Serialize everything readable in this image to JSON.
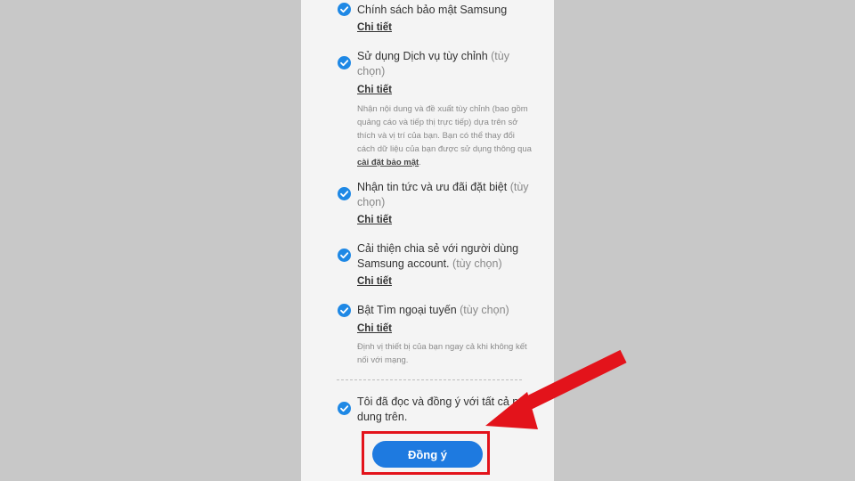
{
  "consents": [
    {
      "title": "Chính sách bảo mật Samsung",
      "optional": "",
      "detail": "Chi tiết",
      "description": ""
    },
    {
      "title": "Sử dụng Dịch vụ tùy chỉnh",
      "optional": "(tùy chọn)",
      "detail": "Chi tiết",
      "description_before": "Nhận nội dung và đề xuất tùy chỉnh (bao gồm quảng cáo và tiếp thị trực tiếp) dựa trên sở thích và vị trí của bạn. Bạn có thể thay đổi cách dữ liệu của bạn được sử dụng thông qua ",
      "description_link": "cài đặt bảo mật",
      "description_after": "."
    },
    {
      "title": "Nhận tin tức và ưu đãi đặt biệt",
      "optional": "(tùy chọn)",
      "detail": "Chi tiết",
      "description": ""
    },
    {
      "title": "Cải thiện chia sẻ với người dùng Samsung account.",
      "optional": "(tùy chọn)",
      "detail": "Chi tiết",
      "description": ""
    },
    {
      "title": "Bật Tìm ngoại tuyến",
      "optional": "(tùy chọn)",
      "detail": "Chi tiết",
      "description": "Định vị thiết bị của bạn ngay cả khi không kết nối với mạng."
    }
  ],
  "agree_all": "Tôi đã đọc và đồng ý với tất cả nội dung trên.",
  "agree_button": "Đồng ý",
  "colors": {
    "check": "#1e88e5",
    "button": "#1e7ae0",
    "annotation": "#e3131b"
  }
}
